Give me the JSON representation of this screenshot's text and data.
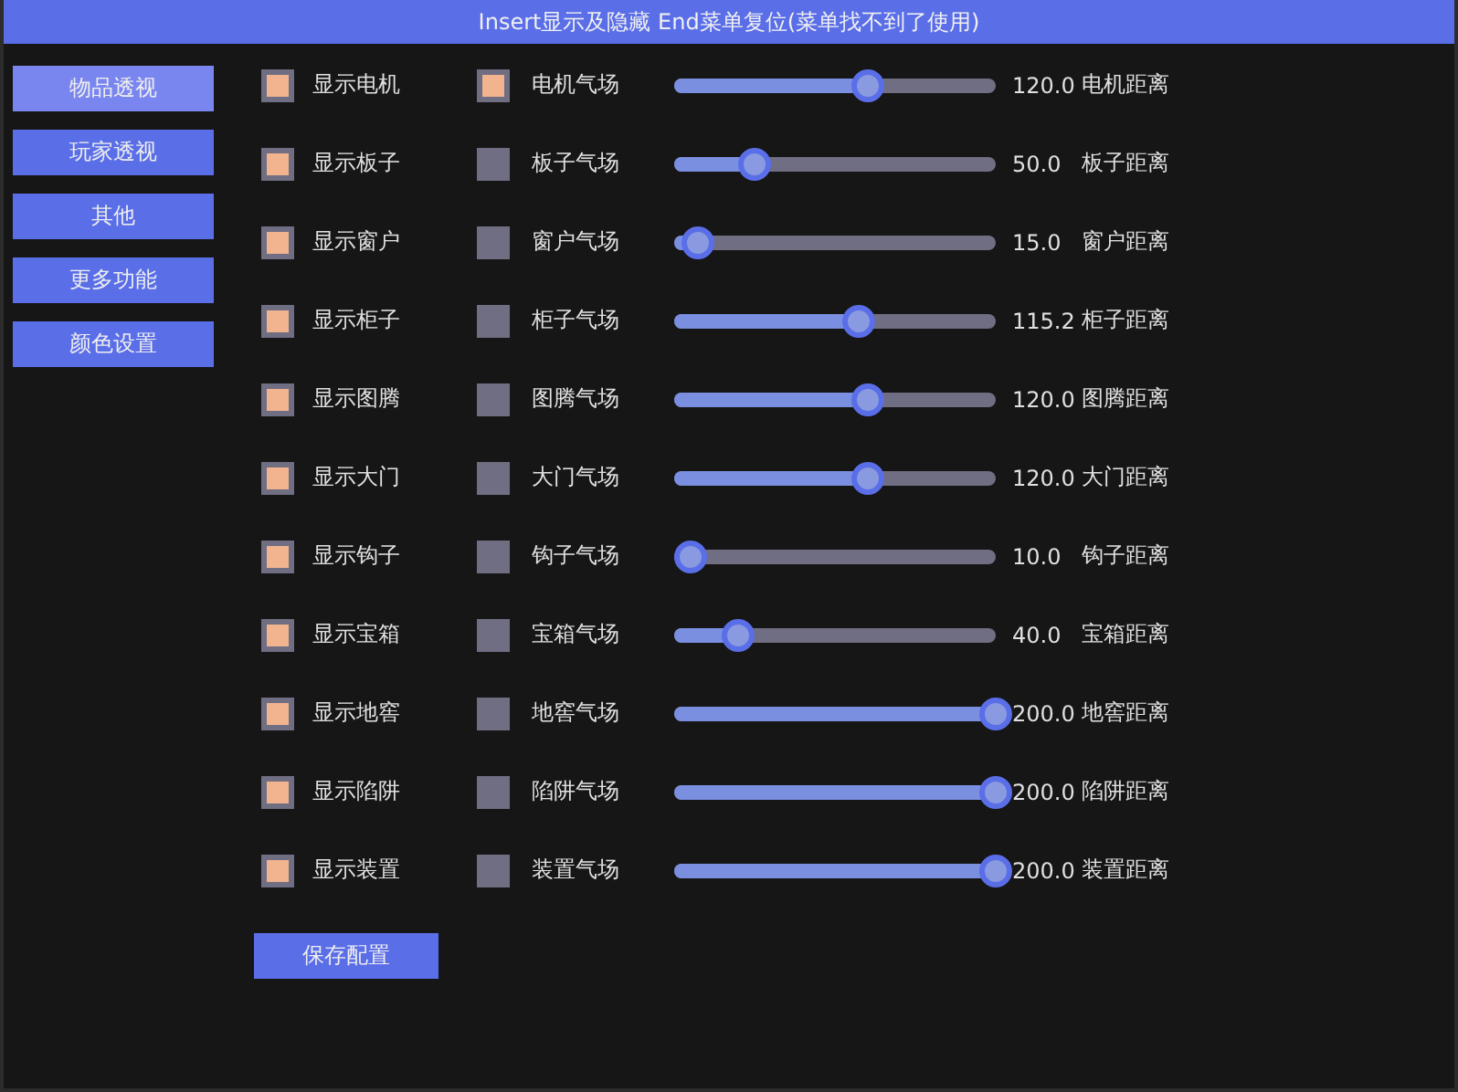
{
  "window": {
    "title": "Insert显示及隐藏 End菜单复位(菜单找不到了使用)"
  },
  "sidebar": {
    "items": [
      {
        "label": "物品透视",
        "selected": true
      },
      {
        "label": "玩家透视",
        "selected": false
      },
      {
        "label": "其他",
        "selected": false
      },
      {
        "label": "更多功能",
        "selected": false
      },
      {
        "label": "颜色设置",
        "selected": false
      }
    ]
  },
  "rows": [
    {
      "show_label": "显示电机",
      "show_checked": true,
      "field_label": "电机气场",
      "field_checked": true,
      "level": 0.6,
      "value": "120.0",
      "distance_label": "电机距离"
    },
    {
      "show_label": "显示板子",
      "show_checked": true,
      "field_label": "板子气场",
      "field_checked": false,
      "level": 0.25,
      "value": "50.0",
      "distance_label": "板子距离"
    },
    {
      "show_label": "显示窗户",
      "show_checked": true,
      "field_label": "窗户气场",
      "field_checked": false,
      "level": 0.075,
      "value": "15.0",
      "distance_label": "窗户距离"
    },
    {
      "show_label": "显示柜子",
      "show_checked": true,
      "field_label": "柜子气场",
      "field_checked": false,
      "level": 0.576,
      "value": "115.2",
      "distance_label": "柜子距离"
    },
    {
      "show_label": "显示图腾",
      "show_checked": true,
      "field_label": "图腾气场",
      "field_checked": false,
      "level": 0.6,
      "value": "120.0",
      "distance_label": "图腾距离"
    },
    {
      "show_label": "显示大门",
      "show_checked": true,
      "field_label": "大门气场",
      "field_checked": false,
      "level": 0.6,
      "value": "120.0",
      "distance_label": "大门距离"
    },
    {
      "show_label": "显示钩子",
      "show_checked": true,
      "field_label": "钩子气场",
      "field_checked": false,
      "level": 0.05,
      "value": "10.0",
      "distance_label": "钩子距离"
    },
    {
      "show_label": "显示宝箱",
      "show_checked": true,
      "field_label": "宝箱气场",
      "field_checked": false,
      "level": 0.2,
      "value": "40.0",
      "distance_label": "宝箱距离"
    },
    {
      "show_label": "显示地窖",
      "show_checked": true,
      "field_label": "地窖气场",
      "field_checked": false,
      "level": 1,
      "value": "200.0",
      "distance_label": "地窖距离"
    },
    {
      "show_label": "显示陷阱",
      "show_checked": true,
      "field_label": "陷阱气场",
      "field_checked": false,
      "level": 1,
      "value": "200.0",
      "distance_label": "陷阱距离"
    },
    {
      "show_label": "显示装置",
      "show_checked": true,
      "field_label": "装置气场",
      "field_checked": false,
      "level": 1,
      "value": "200.0",
      "distance_label": "装置距离"
    }
  ],
  "save_button": "保存配置"
}
